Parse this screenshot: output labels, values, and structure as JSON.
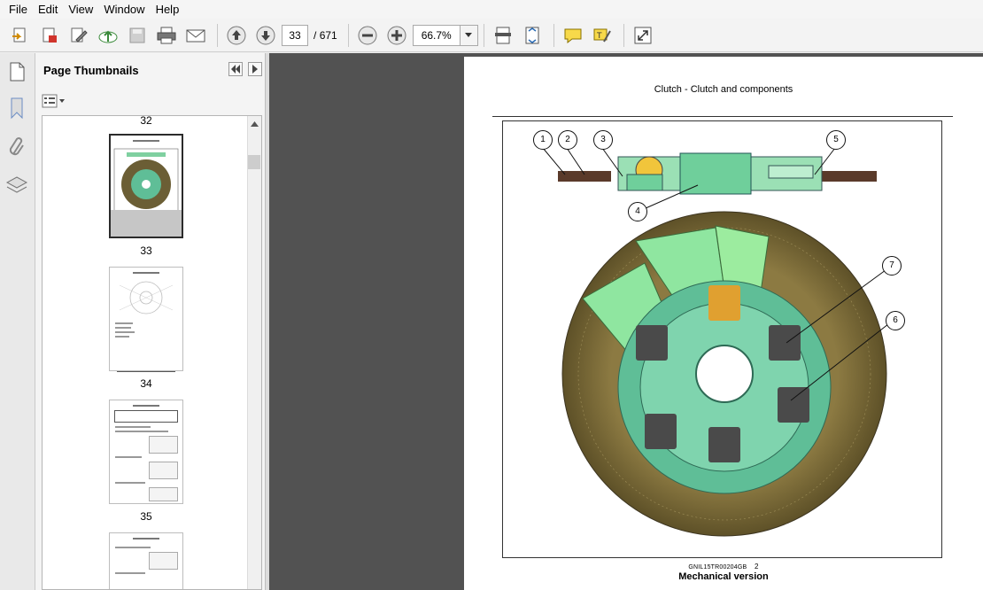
{
  "menu": [
    "File",
    "Edit",
    "View",
    "Window",
    "Help"
  ],
  "toolbar": {
    "current_page": "33",
    "page_separator": "/",
    "page_count": "671",
    "zoom": "66.7%"
  },
  "thumbnails": {
    "title": "Page Thumbnails",
    "pages": [
      {
        "label": "32"
      },
      {
        "label": "33"
      },
      {
        "label": "34"
      },
      {
        "label": "35"
      }
    ]
  },
  "document": {
    "header": "Clutch - Clutch and components",
    "figure_code": "GNIL15TR00204GB",
    "figure_number": "2",
    "caption": "Mechanical version",
    "callouts": [
      "1",
      "2",
      "3",
      "4",
      "5",
      "6",
      "7"
    ]
  },
  "colors": {
    "friction": "#7a6a3a",
    "hub": "#6dc8a8",
    "plate": "#8ee69c",
    "spring": "#4a4a4a",
    "doc_bg": "#525252"
  }
}
